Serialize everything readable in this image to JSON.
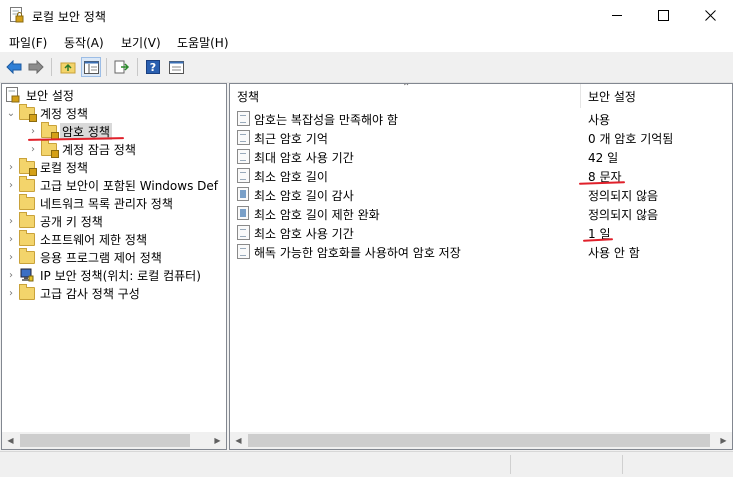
{
  "window": {
    "title": "로컬 보안 정책"
  },
  "menu": [
    "파일(F)",
    "동작(A)",
    "보기(V)",
    "도움말(H)"
  ],
  "toolbar": {
    "buttons": [
      "back-arrow-icon",
      "forward-arrow-icon",
      "up-folder-icon",
      "show-hide-tree-icon",
      "export-list-icon",
      "help-icon",
      "properties-icon"
    ]
  },
  "tree": {
    "root": "보안 설정",
    "items": [
      {
        "label": "계정 정책",
        "expanded": true
      },
      {
        "label": "암호 정책",
        "selected": true
      },
      {
        "label": "계정 잠금 정책"
      },
      {
        "label": "로컬 정책"
      },
      {
        "label": "고급 보안이 포함된 Windows Def"
      },
      {
        "label": "네트워크 목록 관리자 정책"
      },
      {
        "label": "공개 키 정책"
      },
      {
        "label": "소프트웨어 제한 정책"
      },
      {
        "label": "응용 프로그램 제어 정책"
      },
      {
        "label": "IP 보안 정책(위치: 로컬 컴퓨터)"
      },
      {
        "label": "고급 감사 정책 구성"
      }
    ]
  },
  "list": {
    "columns": {
      "policy": "정책",
      "setting": "보안 설정"
    },
    "rows": [
      {
        "policy": "암호는 복잡성을 만족해야 함",
        "setting": "사용"
      },
      {
        "policy": "최근 암호 기억",
        "setting": "0 개 암호 기억됨"
      },
      {
        "policy": "최대 암호 사용 기간",
        "setting": "42 일"
      },
      {
        "policy": "최소 암호 길이",
        "setting": "8 문자"
      },
      {
        "policy": "최소 암호 길이 감사",
        "setting": "정의되지 않음"
      },
      {
        "policy": "최소 암호 길이 제한 완화",
        "setting": "정의되지 않음"
      },
      {
        "policy": "최소 암호 사용 기간",
        "setting": "1 일"
      },
      {
        "policy": "해독 가능한 암호화를 사용하여 암호 저장",
        "setting": "사용 안 함"
      }
    ]
  },
  "colors": {
    "accent": "#0078d7",
    "annotation": "#e0202a"
  }
}
